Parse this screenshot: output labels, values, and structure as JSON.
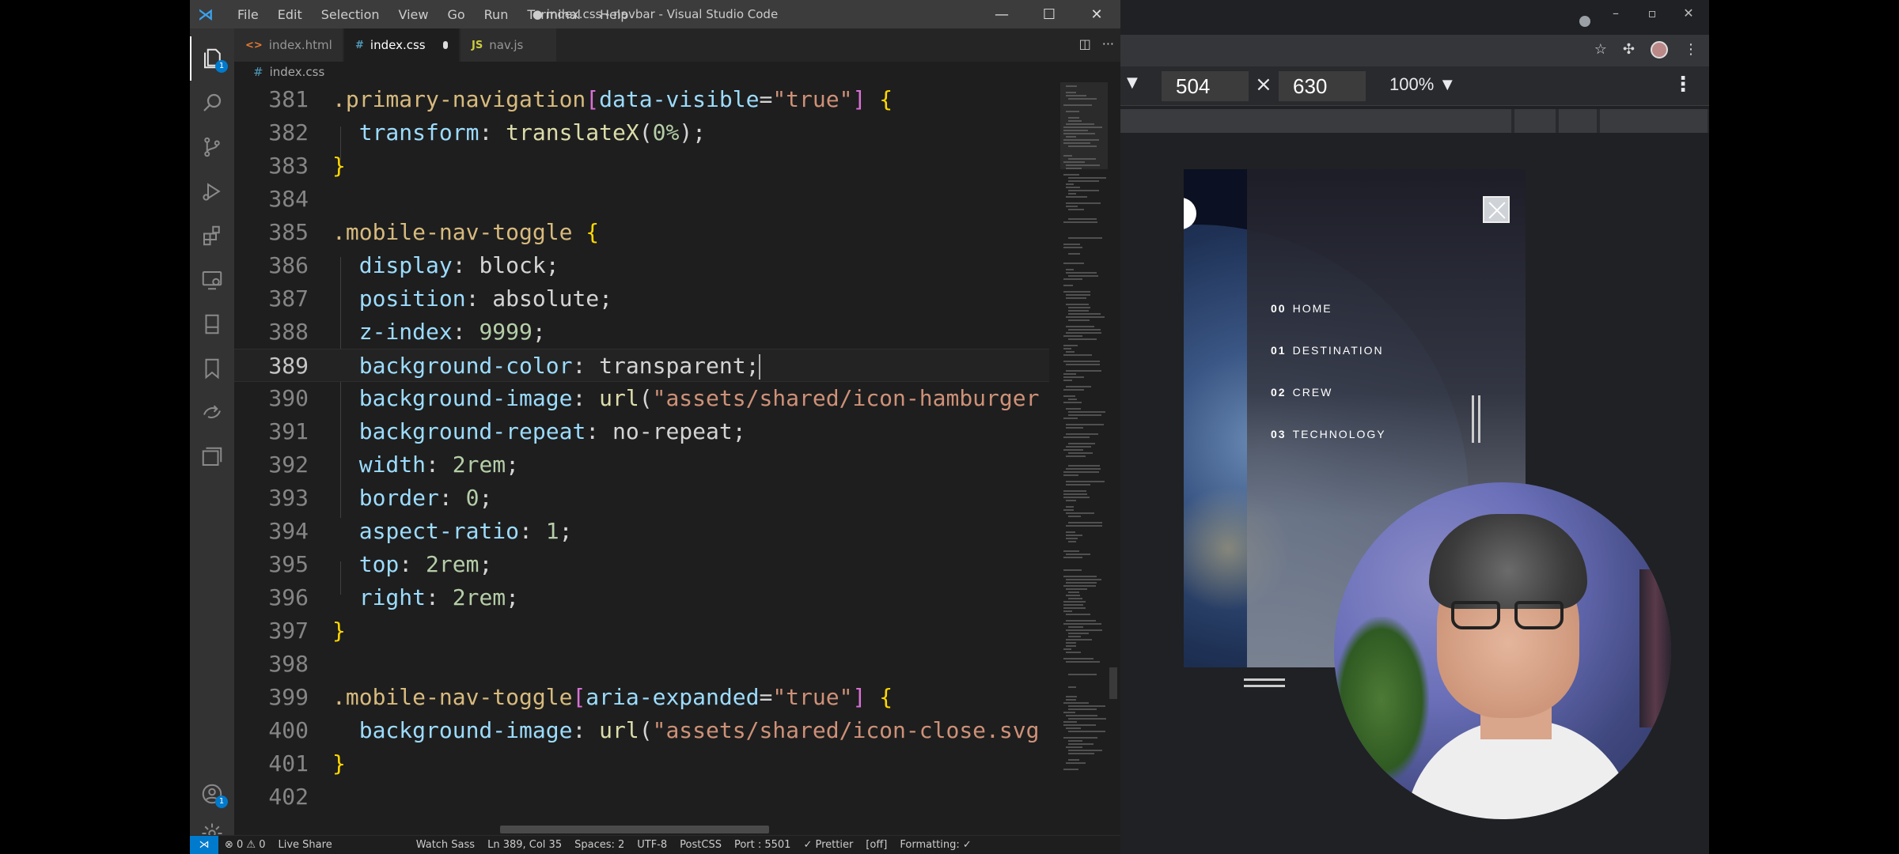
{
  "vscode": {
    "menu": [
      "File",
      "Edit",
      "Selection",
      "View",
      "Go",
      "Run",
      "Terminal",
      "Help"
    ],
    "title": "● index.css - navbar - Visual Studio Code",
    "tabs": [
      {
        "icon": "<>",
        "label": "index.html"
      },
      {
        "icon": "#",
        "label": "index.css"
      },
      {
        "icon": "JS",
        "label": "nav.js"
      }
    ],
    "breadcrumb": "index.css",
    "status": {
      "errors": "⊗ 0 ⚠ 0",
      "live_share": "Live Share",
      "watch_sass": "Watch Sass",
      "position": "Ln 389, Col 35",
      "spaces": "Spaces: 2",
      "encoding": "UTF-8",
      "language": "PostCSS",
      "port": "Port : 5501",
      "prettier": "✓ Prettier",
      "off": "[off]",
      "formatting": "Formatting: ✓"
    },
    "badges": {
      "explorer": "1",
      "accounts": "1"
    }
  },
  "code_lines": [
    {
      "n": "381",
      "segs": [
        [
          "sel",
          ".primary-navigation"
        ],
        [
          "brk",
          "["
        ],
        [
          "attr",
          "data-visible"
        ],
        [
          "punc",
          "="
        ],
        [
          "str",
          "\"true\""
        ],
        [
          "brk",
          "]"
        ],
        [
          "punc",
          " "
        ],
        [
          "brace",
          "{"
        ]
      ]
    },
    {
      "n": "382",
      "segs": [
        [
          "punc",
          "  "
        ],
        [
          "prop",
          "transform"
        ],
        [
          "punc",
          ": "
        ],
        [
          "fn",
          "translateX"
        ],
        [
          "punc",
          "("
        ],
        [
          "num",
          "0%"
        ],
        [
          "punc",
          ");"
        ]
      ]
    },
    {
      "n": "383",
      "segs": [
        [
          "brace",
          "}"
        ]
      ]
    },
    {
      "n": "384",
      "segs": []
    },
    {
      "n": "385",
      "segs": [
        [
          "sel",
          ".mobile-nav-toggle"
        ],
        [
          "punc",
          " "
        ],
        [
          "brace",
          "{"
        ]
      ]
    },
    {
      "n": "386",
      "segs": [
        [
          "punc",
          "  "
        ],
        [
          "prop",
          "display"
        ],
        [
          "punc",
          ": "
        ],
        [
          "punc",
          "block"
        ],
        [
          "punc",
          ";"
        ]
      ]
    },
    {
      "n": "387",
      "segs": [
        [
          "punc",
          "  "
        ],
        [
          "prop",
          "position"
        ],
        [
          "punc",
          ": "
        ],
        [
          "punc",
          "absolute"
        ],
        [
          "punc",
          ";"
        ]
      ]
    },
    {
      "n": "388",
      "segs": [
        [
          "punc",
          "  "
        ],
        [
          "prop",
          "z-index"
        ],
        [
          "punc",
          ": "
        ],
        [
          "num",
          "9999"
        ],
        [
          "punc",
          ";"
        ]
      ]
    },
    {
      "n": "389",
      "segs": [
        [
          "punc",
          "  "
        ],
        [
          "prop",
          "background-color"
        ],
        [
          "punc",
          ": "
        ],
        [
          "punc",
          "transparent"
        ],
        [
          "punc",
          ";"
        ]
      ],
      "current": true
    },
    {
      "n": "390",
      "segs": [
        [
          "punc",
          "  "
        ],
        [
          "prop",
          "background-image"
        ],
        [
          "punc",
          ": "
        ],
        [
          "fn",
          "url"
        ],
        [
          "punc",
          "("
        ],
        [
          "str",
          "\"assets/shared/icon-hamburger"
        ]
      ]
    },
    {
      "n": "391",
      "segs": [
        [
          "punc",
          "  "
        ],
        [
          "prop",
          "background-repeat"
        ],
        [
          "punc",
          ": "
        ],
        [
          "punc",
          "no-repeat"
        ],
        [
          "punc",
          ";"
        ]
      ]
    },
    {
      "n": "392",
      "segs": [
        [
          "punc",
          "  "
        ],
        [
          "prop",
          "width"
        ],
        [
          "punc",
          ": "
        ],
        [
          "num",
          "2rem"
        ],
        [
          "punc",
          ";"
        ]
      ]
    },
    {
      "n": "393",
      "segs": [
        [
          "punc",
          "  "
        ],
        [
          "prop",
          "border"
        ],
        [
          "punc",
          ": "
        ],
        [
          "num",
          "0"
        ],
        [
          "punc",
          ";"
        ]
      ]
    },
    {
      "n": "394",
      "segs": [
        [
          "punc",
          "  "
        ],
        [
          "prop",
          "aspect-ratio"
        ],
        [
          "punc",
          ": "
        ],
        [
          "num",
          "1"
        ],
        [
          "punc",
          ";"
        ]
      ]
    },
    {
      "n": "395",
      "segs": [
        [
          "punc",
          "  "
        ],
        [
          "prop",
          "top"
        ],
        [
          "punc",
          ": "
        ],
        [
          "num",
          "2rem"
        ],
        [
          "punc",
          ";"
        ]
      ]
    },
    {
      "n": "396",
      "segs": [
        [
          "punc",
          "  "
        ],
        [
          "prop",
          "right"
        ],
        [
          "punc",
          ": "
        ],
        [
          "num",
          "2rem"
        ],
        [
          "punc",
          ";"
        ]
      ]
    },
    {
      "n": "397",
      "segs": [
        [
          "brace",
          "}"
        ]
      ]
    },
    {
      "n": "398",
      "segs": []
    },
    {
      "n": "399",
      "segs": [
        [
          "sel",
          ".mobile-nav-toggle"
        ],
        [
          "brk",
          "["
        ],
        [
          "attr",
          "aria-expanded"
        ],
        [
          "punc",
          "="
        ],
        [
          "str",
          "\"true\""
        ],
        [
          "brk",
          "]"
        ],
        [
          "punc",
          " "
        ],
        [
          "brace",
          "{"
        ]
      ]
    },
    {
      "n": "400",
      "segs": [
        [
          "punc",
          "  "
        ],
        [
          "prop",
          "background-image"
        ],
        [
          "punc",
          ": "
        ],
        [
          "fn",
          "url"
        ],
        [
          "punc",
          "("
        ],
        [
          "str",
          "\"assets/shared/icon-close.svg"
        ]
      ]
    },
    {
      "n": "401",
      "segs": [
        [
          "brace",
          "}"
        ]
      ]
    },
    {
      "n": "402",
      "segs": []
    }
  ],
  "devtools": {
    "width": "504",
    "times": "×",
    "height": "630",
    "zoom": "100%"
  },
  "site_nav": [
    {
      "num": "00",
      "label": "HOME"
    },
    {
      "num": "01",
      "label": "DESTINATION"
    },
    {
      "num": "02",
      "label": "CREW"
    },
    {
      "num": "03",
      "label": "TECHNOLOGY"
    }
  ]
}
